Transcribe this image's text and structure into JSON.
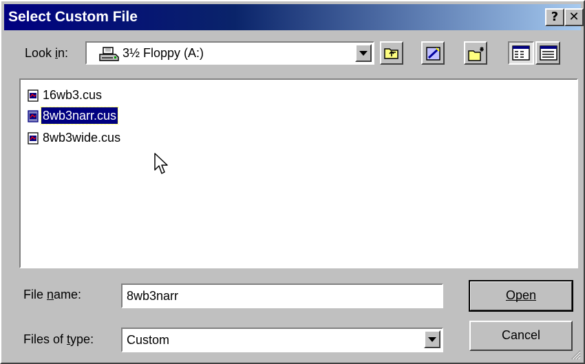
{
  "dialog": {
    "title": "Select Custom File",
    "help_glyph": "?",
    "close_glyph": "✕"
  },
  "lookin": {
    "label": "Look in:",
    "value": "3½ Floppy (A:)",
    "icon": "floppy-drive-icon"
  },
  "toolbar": {
    "buttons": [
      "up-one-level-icon",
      "desktop-icon",
      "new-folder-icon",
      "list-view-icon",
      "details-view-icon"
    ]
  },
  "files": [
    {
      "name": "16wb3.cus",
      "selected": false
    },
    {
      "name": "8wb3narr.cus",
      "selected": true
    },
    {
      "name": "8wb3wide.cus",
      "selected": false
    }
  ],
  "filename": {
    "label": "File name:",
    "value": "8wb3narr"
  },
  "filetype": {
    "label": "Files of type:",
    "value": "Custom"
  },
  "buttons": {
    "open_label": "Open",
    "cancel_label": "Cancel"
  },
  "colors": {
    "title_bar": "#000080",
    "selection": "#000080",
    "face": "#c0c0c0"
  }
}
